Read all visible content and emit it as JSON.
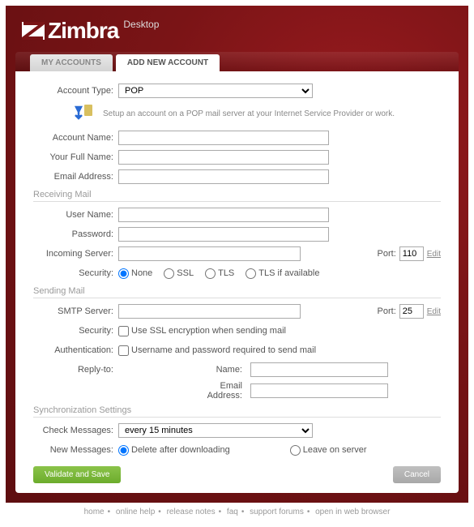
{
  "app": {
    "name": "Zimbra",
    "edition": "Desktop"
  },
  "tabs": {
    "my_accounts": "MY ACCOUNTS",
    "add_new": "ADD NEW ACCOUNT"
  },
  "form": {
    "account_type_label": "Account Type:",
    "account_type_value": "POP",
    "setup_desc": "Setup an account on a POP mail server at your Internet Service Provider or work.",
    "account_name_label": "Account Name:",
    "full_name_label": "Your Full Name:",
    "email_label": "Email Address:",
    "sect_recv": "Receiving Mail",
    "user_name_label": "User Name:",
    "password_label": "Password:",
    "incoming_label": "Incoming Server:",
    "port_label": "Port:",
    "incoming_port": "110",
    "edit_link": "Edit",
    "security_label": "Security:",
    "sec_none": "None",
    "sec_ssl": "SSL",
    "sec_tls": "TLS",
    "sec_tls_avail": "TLS if available",
    "sect_send": "Sending Mail",
    "smtp_label": "SMTP Server:",
    "smtp_port": "25",
    "send_security_chk": "Use SSL encryption when sending mail",
    "auth_label": "Authentication:",
    "auth_chk": "Username and password required to send mail",
    "reply_to_label": "Reply-to:",
    "reply_name_label": "Name:",
    "reply_email_label": "Email Address:",
    "sect_sync": "Synchronization Settings",
    "check_label": "Check Messages:",
    "check_value": "every 15 minutes",
    "new_msg_label": "New Messages:",
    "new_delete": "Delete after downloading",
    "new_leave": "Leave on server",
    "btn_validate": "Validate and Save",
    "btn_cancel": "Cancel"
  },
  "footer": {
    "home": "home",
    "help": "online help",
    "notes": "release notes",
    "faq": "faq",
    "forums": "support forums",
    "browser": "open in web browser"
  }
}
